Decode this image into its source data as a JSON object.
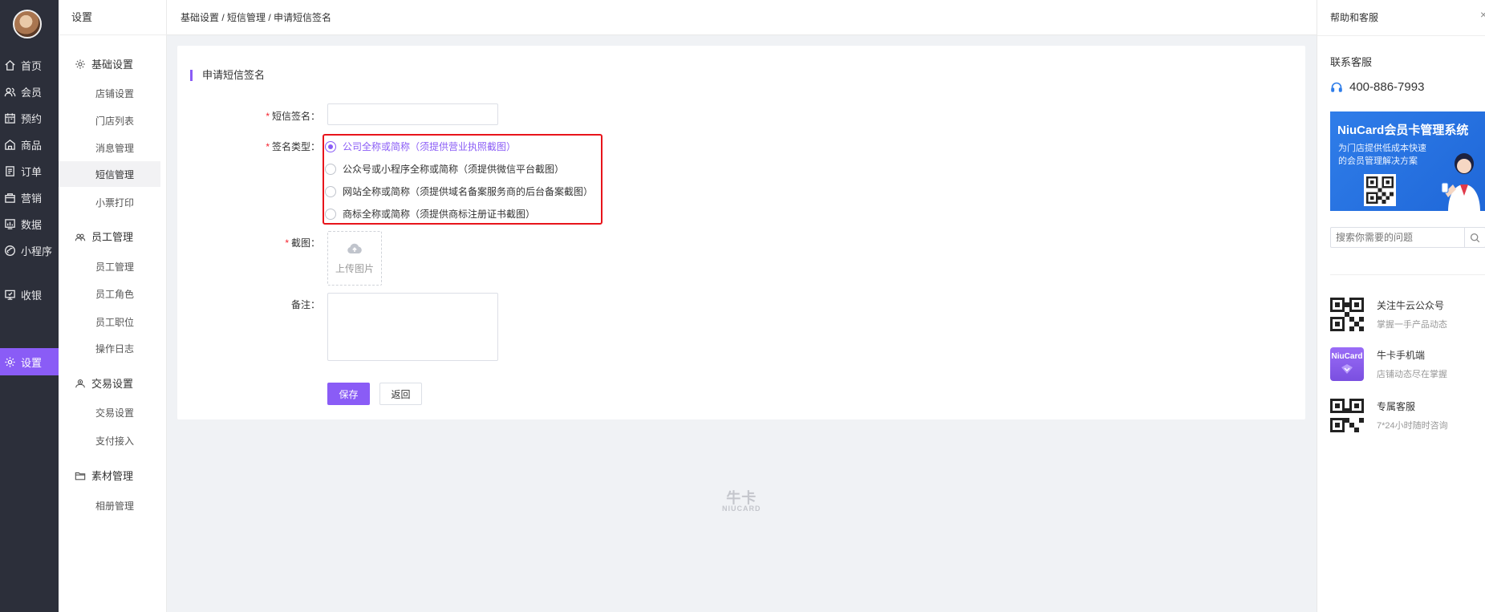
{
  "nav": {
    "items": [
      {
        "label": "首页",
        "icon": "home-icon"
      },
      {
        "label": "会员",
        "icon": "member-icon"
      },
      {
        "label": "预约",
        "icon": "calendar-icon"
      },
      {
        "label": "商品",
        "icon": "shop-icon"
      },
      {
        "label": "订单",
        "icon": "order-icon"
      },
      {
        "label": "营销",
        "icon": "marketing-icon"
      },
      {
        "label": "数据",
        "icon": "chart-icon"
      },
      {
        "label": "小程序",
        "icon": "miniprogram-icon"
      },
      {
        "label": "收银",
        "icon": "cashier-icon"
      },
      {
        "label": "设置",
        "icon": "gear-icon"
      }
    ],
    "active": "设置"
  },
  "submenu": {
    "title": "设置",
    "groups": [
      {
        "label": "基础设置",
        "items": [
          "店铺设置",
          "门店列表",
          "消息管理",
          "短信管理",
          "小票打印"
        ]
      },
      {
        "label": "员工管理",
        "items": [
          "员工管理",
          "员工角色",
          "员工职位",
          "操作日志"
        ]
      },
      {
        "label": "交易设置",
        "items": [
          "交易设置",
          "支付接入"
        ]
      },
      {
        "label": "素材管理",
        "items": [
          "相册管理"
        ]
      }
    ],
    "active_item": "短信管理"
  },
  "breadcrumb": "基础设置 / 短信管理 / 申请短信签名",
  "form": {
    "title": "申请短信签名",
    "sign_label": "短信签名：",
    "sign_value": "",
    "type_label": "签名类型：",
    "type_options": [
      "公司全称或简称（须提供营业执照截图）",
      "公众号或小程序全称或简称（须提供微信平台截图）",
      "网站全称或简称（须提供域名备案服务商的后台备案截图）",
      "商标全称或简称（须提供商标注册证书截图）"
    ],
    "type_selected": 0,
    "screenshot_label": "截图：",
    "upload_text": "上传图片",
    "remark_label": "备注：",
    "remark_value": "",
    "save_label": "保存",
    "back_label": "返回",
    "required_mark": "*"
  },
  "watermark": {
    "text": "牛卡",
    "sub": "NIUCARD"
  },
  "help": {
    "title": "帮助和客服",
    "close": "×",
    "contact_title": "联系客服",
    "phone": "400-886-7993",
    "banner_title": "NiuCard会员卡管理系统",
    "banner_sub": "为门店提供低成本快速的会员管理解决方案",
    "search_placeholder": "搜索你需要的问题",
    "items": [
      {
        "title": "关注牛云公众号",
        "sub": "掌握一手产品动态"
      },
      {
        "title": "牛卡手机端",
        "sub": "店铺动态尽在掌握",
        "badge": "NiuCard"
      },
      {
        "title": "专属客服",
        "sub": "7*24小时随时咨询"
      }
    ]
  },
  "colors": {
    "accent": "#8a5cf6",
    "nav_bg": "#2c2f3a",
    "highlight_border": "#e8141b",
    "banner": "#2f7de9"
  }
}
